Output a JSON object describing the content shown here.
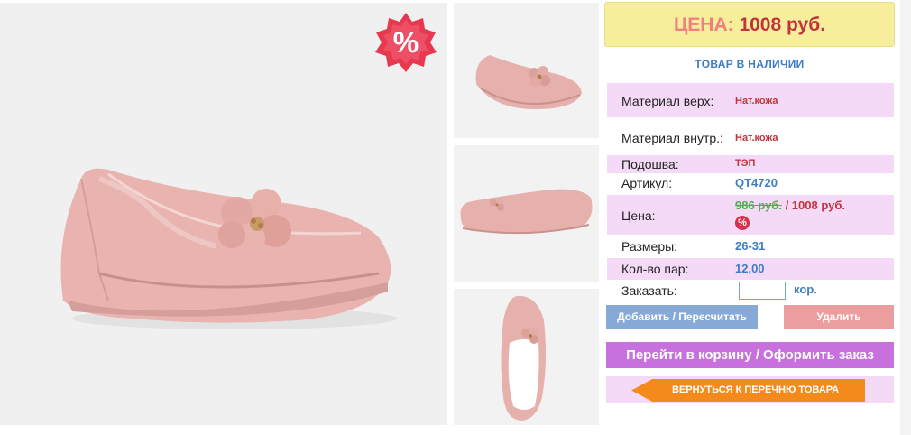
{
  "badge": {
    "symbol": "%",
    "color": "#e8384f"
  },
  "price_header": {
    "label": "ЦЕНА:",
    "value": "1008 руб."
  },
  "stock": "ТОВАР В НАЛИЧИИ",
  "specs": {
    "material_top": {
      "key": "Материал верх:",
      "value": "Нат.кожа"
    },
    "material_inner": {
      "key": "Материал внутр.:",
      "value": "Нат.кожа"
    },
    "sole": {
      "key": "Подошва:",
      "value": "ТЭП"
    },
    "article": {
      "key": "Артикул:",
      "value": "QT4720"
    },
    "price": {
      "key": "Цена:",
      "old": "986 руб.",
      "separator": " / ",
      "new": "1008 руб.",
      "discount_symbol": "%"
    },
    "sizes": {
      "key": "Размеры:",
      "value": "26-31"
    },
    "pairs": {
      "key": "Кол-во пар:",
      "value": "12,00"
    },
    "order": {
      "key": "Заказать:",
      "value": "",
      "unit": "кор."
    }
  },
  "buttons": {
    "add": "Добавить / Пересчитать",
    "delete": "Удалить",
    "cart": "Перейти в корзину / Оформить заказ",
    "back": "ВЕРНУТЬСЯ К ПЕРЕЧНЮ ТОВАРА"
  },
  "colors": {
    "accent_pink": "#f4daf6",
    "price_red": "#c0343c",
    "link_blue": "#3e7cc4",
    "cart_purple": "#c770de",
    "back_orange": "#f48a1c"
  }
}
